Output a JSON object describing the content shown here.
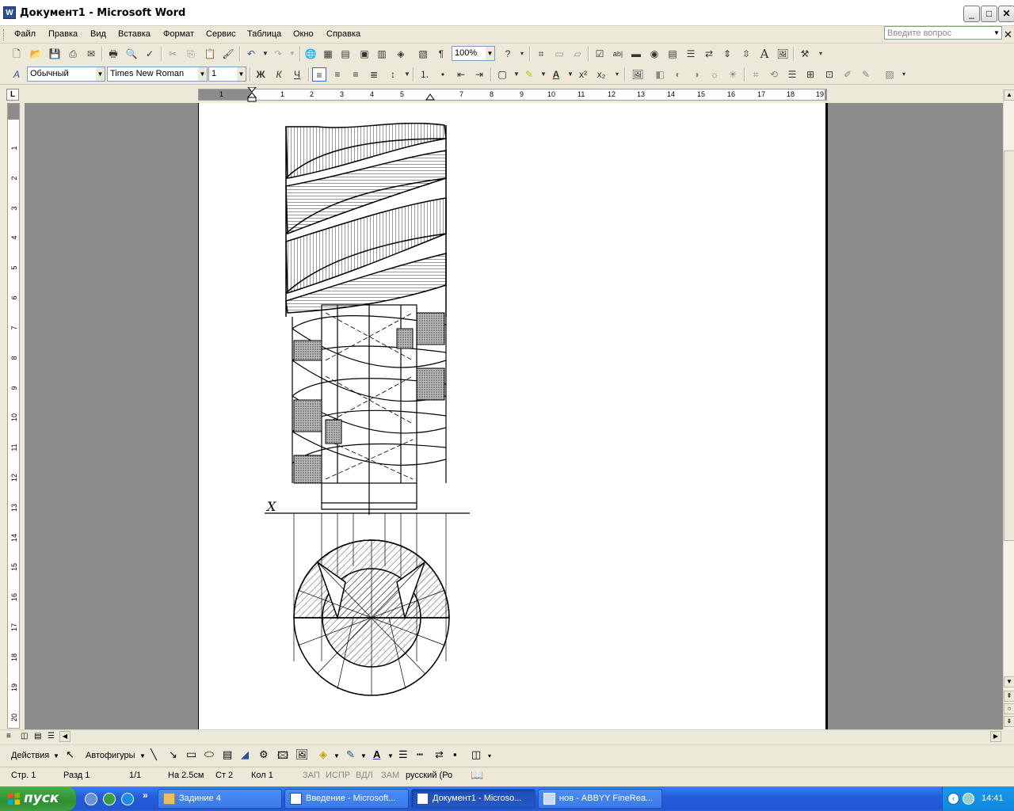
{
  "window": {
    "title": "Документ1 - Microsoft Word",
    "minimize": "_",
    "maximize": "□",
    "close": "✕"
  },
  "menu": [
    "Файл",
    "Правка",
    "Вид",
    "Вставка",
    "Формат",
    "Сервис",
    "Таблица",
    "Окно",
    "Справка"
  ],
  "help_placeholder": "Введите вопрос",
  "toolbar": {
    "zoom": "100%",
    "style": "Обычный",
    "font": "Times New Roman",
    "size": "1"
  },
  "ruler": {
    "h_labels": [
      "1",
      "1",
      "2",
      "3",
      "4",
      "5",
      "7",
      "8",
      "9",
      "10",
      "11",
      "12",
      "13",
      "14",
      "15",
      "16",
      "17",
      "18",
      "19"
    ],
    "v_labels": [
      "1",
      "2",
      "3",
      "4",
      "5",
      "6",
      "7",
      "8",
      "9",
      "10",
      "11",
      "12",
      "13",
      "14",
      "15",
      "16",
      "17",
      "18",
      "19",
      "20"
    ],
    "corner": "L"
  },
  "drawing": {
    "axis_label": "X"
  },
  "drawbar": {
    "actions": "Действия",
    "autoshapes": "Автофигуры"
  },
  "status": {
    "page": "Стр. 1",
    "section": "Разд 1",
    "pages": "1/1",
    "at": "На 2.5см",
    "line": "Ст 2",
    "col": "Кол 1",
    "rec": "ЗАП",
    "trk": "ИСПР",
    "ext": "ВДЛ",
    "ovr": "ЗАМ",
    "lang": "русский (Ро"
  },
  "taskbar": {
    "start": "пуск",
    "tasks": [
      {
        "label": "Задиние 4",
        "icon": "folder-icon"
      },
      {
        "label": "Введение - Microsoft...",
        "icon": "word-icon"
      },
      {
        "label": "Документ1 - Microso...",
        "icon": "word-icon"
      },
      {
        "label": "нов - ABBYY FineRea...",
        "icon": "abbyy-icon"
      }
    ],
    "clock": "14:41"
  },
  "colors": {
    "taskbar": "#245edb",
    "start": "#3b9e3d",
    "workspace": "#8c8c8c"
  }
}
